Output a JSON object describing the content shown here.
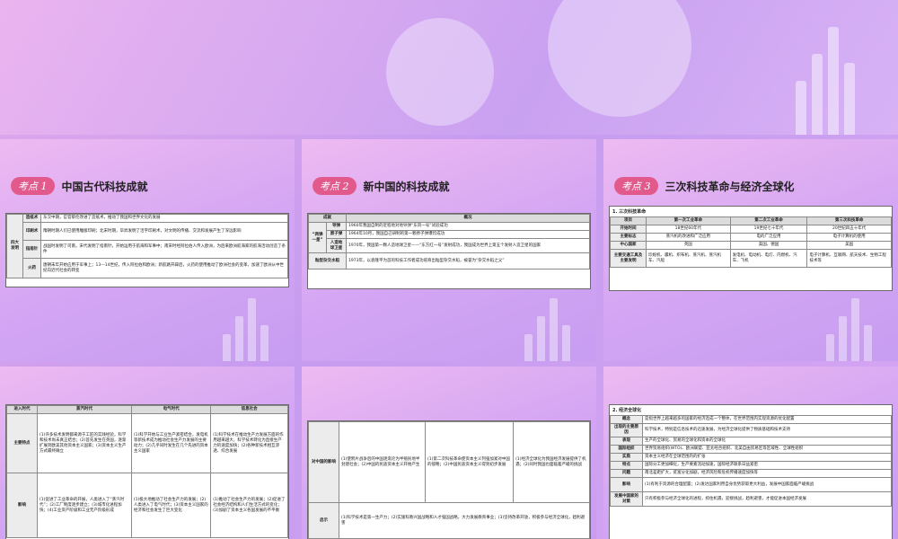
{
  "s1": {
    "badge": "考点 1",
    "title": "中国古代科技成就",
    "group": "四大发明",
    "rows": [
      {
        "name": "造纸术",
        "text": "东汉中期，宦官蔡伦改进了造纸术，推动了我国和世界文化的发展"
      },
      {
        "name": "印刷术",
        "text": "隋朝时期人们已使用雕版印刷；北宋时期，毕昇发明了活字印刷术，对文明的传播、交流和发展产生了深远影响"
      },
      {
        "name": "指南针",
        "text": "战国时发明了司南，宋代发明了指南针，开始运用于航海和军事中；南宋时经阿拉伯人传入欧洲，为后来欧洲航海家的航海活动创造了条件"
      },
      {
        "name": "火药",
        "text": "唐朝末年开始应用于军事上；13—14世纪，传入阿拉伯和欧洲；新航路开辟后，火药的使用推动了欧洲社会的变革，加速了欧洲从中世纪向近代社会的转变"
      }
    ]
  },
  "s2": {
    "badge": "考点 2",
    "title": "新中国的科技成就",
    "headers": [
      "成就",
      "概况"
    ],
    "group": "“两弹一星”",
    "rows": [
      {
        "name": "导弹",
        "text": "1960年我国自制的近程地对地导弹“东风一号”试验成功"
      },
      {
        "name": "原子弹",
        "text": "1964年10月，我国自己研制的第一颗原子弹爆炸成功"
      },
      {
        "name": "人造地球卫星",
        "text": "1970年，我国第一颗人造地球卫星——“东方红一号”发射成功，我国成为世界上第五个发射人造卫星的国家"
      }
    ],
    "last": {
      "name": "籼型杂交水稻",
      "text": "1973年，以袁隆平为首的科技工作者成功培育出籼型杂交水稻，被誉为“杂交水稻之父”"
    }
  },
  "s3": {
    "badge": "考点 3",
    "title": "三次科技革命与经济全球化",
    "section": "1. 三次科技革命",
    "headers": [
      "项目",
      "第一次工业革命",
      "第二次工业革命",
      "第三次科技革命"
    ],
    "rows": [
      {
        "name": "开始时间",
        "cells": [
          "18世纪60年代",
          "19世纪七十年代",
          "20世纪四五十年代"
        ]
      },
      {
        "name": "主要标志",
        "cells": [
          "蒸汽机的改进和广泛应用",
          "电的广泛应用",
          "电子计算机的使用"
        ]
      },
      {
        "name": "中心国家",
        "cells": [
          "英国",
          "美国、德国",
          "美国"
        ]
      },
      {
        "name": "主要交通工具及主要发明",
        "cells": [
          "珍妮机、骡机、织布机、蒸汽机、蒸汽机车、汽船",
          "发电机、电动机、电灯、内燃机、汽车、飞机",
          "电子计算机、互联网、航天技术、生物工程技术等"
        ]
      }
    ]
  },
  "s4": {
    "headers": [
      "进入时代",
      "蒸汽时代",
      "电气时代",
      "信息社会"
    ],
    "rows": [
      {
        "name": "主要特点",
        "cells": [
          "(1)许多技术发明都来源于工匠的实践经验，科学和技术尚未真正结合；(2)首先发生在英国，逐渐扩展到欧美其他资本主义国家；(3)资本主义生产方式最终确立",
          "(1)科学开始与工业生产紧密结合，发电机等新技术成为推动社会生产力发展的主要动力；(2)几乎同时发生在几个先进的资本主义国家",
          "(1)科学技术在推动生产力发展方面的作用越来越大，科学技术转化为直接生产力的速度加快；(2)各种新技术相互渗透、综合发展"
        ]
      },
      {
        "name": "影响",
        "cells": [
          "(1)促进了工业革命的开展，人类进入了“蒸汽时代”；(2)工厂制度逐步建立；(3)城市化进程加快；(4)工业资产阶级和工业无产阶级形成",
          "(1)极大地推动了社会生产力的发展；(2)人类进入了电气时代；(3)资本主义国家的经济和社会发生了巨大变化",
          "(1)推动了社会生产力的发展；(2)促进了社会经济结构和人们生活方式的变化；(3)加剧了资本主义各国发展的不平衡"
        ]
      }
    ]
  },
  "s5": {
    "rows": [
      {
        "name": "对中国的影响",
        "cells": [
          "(1)使鸦片战争后的中国逐渐沦为半殖民地半封建社会；(2)中国的民族资本主义开始产生",
          "(1)第二次科技革命使资本主义列强加紧对中国的侵略；(2)中国民族资本主义得到初步发展",
          "(1)经济全球化为我国经济发展提供了机遇；(2)同时我国也面临着严峻的挑战"
        ]
      },
      {
        "name": "启示",
        "cells": [
          "(1)科学技术是第一生产力；(2)实施科教兴国战略和人才强国战略，大力发展教育事业；(3)坚持改革开放，积极参与经济全球化，趋利避害"
        ]
      }
    ]
  },
  "s6": {
    "section": "2. 经济全球化",
    "rows": [
      {
        "name": "概念",
        "text": "是指世界上越来越多的国家的经济连成一个整体，在世界范围内实现资源的优化配置"
      },
      {
        "name": "出现的主要原因",
        "text": "科学技术，特别是信息技术的迅速发展，为经济全球化提供了物质基础和技术支持"
      },
      {
        "name": "表现",
        "text": "生产的全球化、贸易的全球化和资本的全球化"
      },
      {
        "name": "国际组织",
        "text": "世界贸易组织(WTO)、欧洲联盟、亚太经合组织、北美自由贸易区等区域性、全球性组织"
      },
      {
        "name": "实质",
        "text": "资本主义经济在全球范围内的扩张"
      },
      {
        "name": "特点",
        "text": "国际分工更加细化，生产要素流动加速，国际经济联系日益紧密"
      },
      {
        "name": "问题",
        "text": "南北差距扩大，贫富分化加剧，经济风险和危机传播速度加快等"
      },
      {
        "name": "影响",
        "text": "(1)有利于资源的合理配置；(2)发达国家利用自身优势获取更大利益，发展中国家面临严峻挑战"
      },
      {
        "name": "发展中国家的对策",
        "text": "只有积极参与经济全球化的进程，抓住机遇，迎接挑战，趋利避害，才能促进本国经济发展"
      }
    ]
  }
}
